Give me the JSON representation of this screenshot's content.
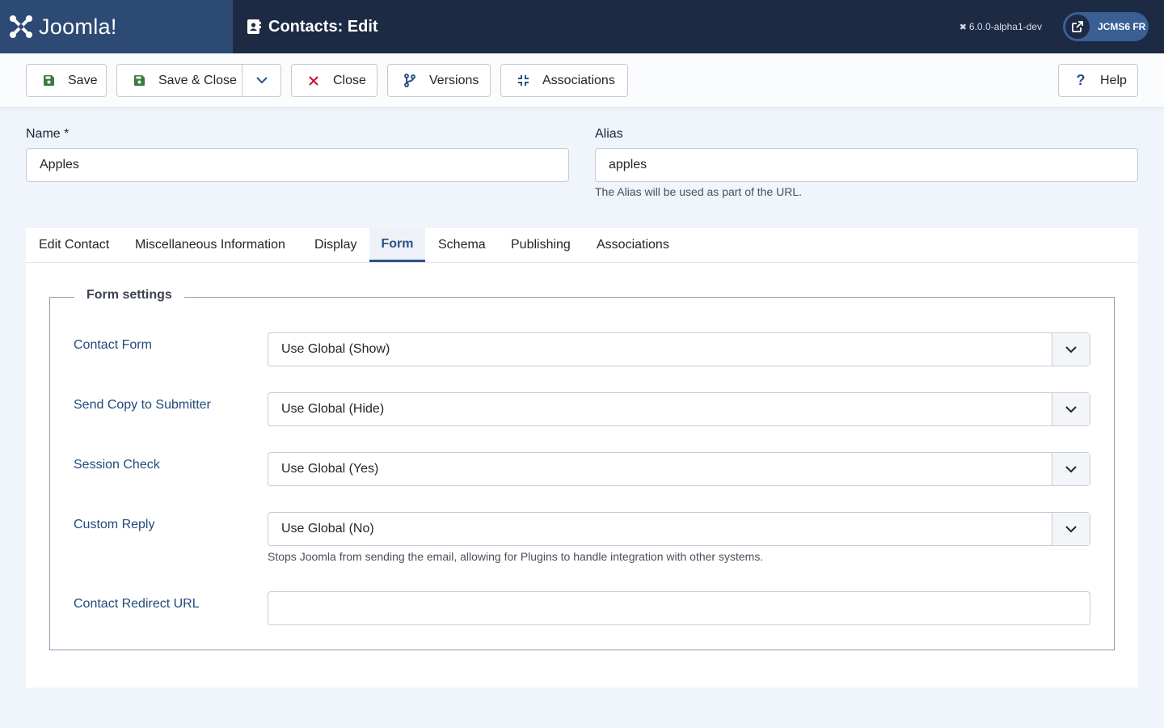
{
  "header": {
    "logo_text": "Joomla!",
    "page_title": "Contacts: Edit",
    "version": "6.0.0-alpha1-dev",
    "site_button": "JCMS6 FR"
  },
  "toolbar": {
    "save": "Save",
    "save_close": "Save & Close",
    "close": "Close",
    "versions": "Versions",
    "associations": "Associations",
    "help": "Help"
  },
  "form": {
    "name_label": "Name *",
    "name_value": "Apples",
    "alias_label": "Alias",
    "alias_value": "apples",
    "alias_hint": "The Alias will be used as part of the URL."
  },
  "tabs": [
    "Edit Contact",
    "Miscellaneous Information",
    "Display",
    "Form",
    "Schema",
    "Publishing",
    "Associations"
  ],
  "form_settings": {
    "legend": "Form settings",
    "fields": [
      {
        "label": "Contact Form",
        "value": "Use Global (Show)"
      },
      {
        "label": "Send Copy to Submitter",
        "value": "Use Global (Hide)"
      },
      {
        "label": "Session Check",
        "value": "Use Global (Yes)"
      },
      {
        "label": "Custom Reply",
        "value": "Use Global (No)",
        "description": "Stops Joomla from sending the email, allowing for Plugins to handle integration with other systems."
      },
      {
        "label": "Contact Redirect URL",
        "value": ""
      }
    ]
  },
  "colors": {
    "header_bg": "#1c2a44",
    "logo_bg": "#2d4a74",
    "accent": "#2d5288",
    "save_icon": "#3c7a3c",
    "close_icon": "#c8102e"
  }
}
